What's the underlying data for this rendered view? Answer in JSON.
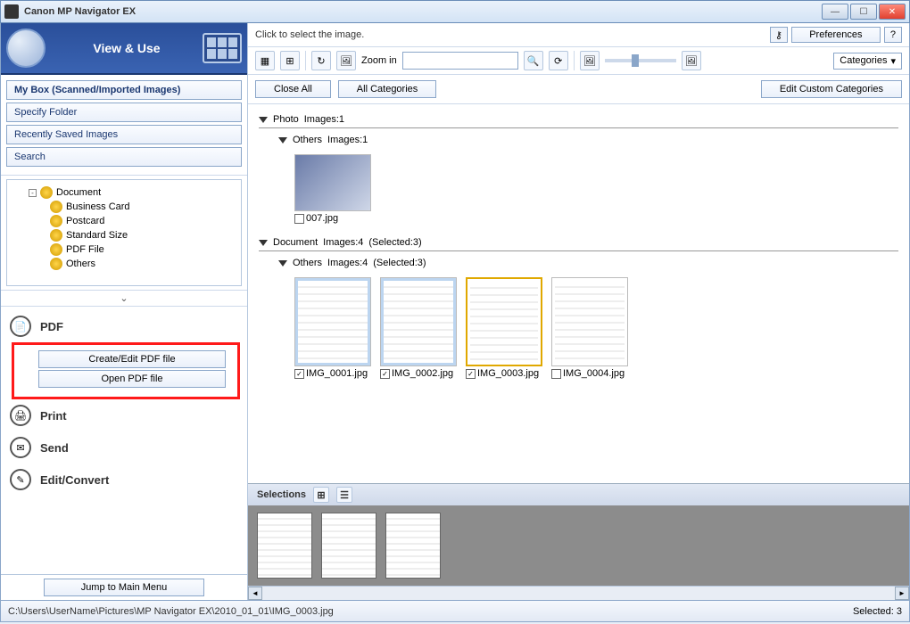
{
  "window": {
    "title": "Canon MP Navigator EX"
  },
  "sidebar": {
    "view_use": "View & Use",
    "items": [
      "My Box (Scanned/Imported Images)",
      "Specify Folder",
      "Recently Saved Images",
      "Search"
    ],
    "tree": {
      "root": "Document",
      "children": [
        "Business Card",
        "Postcard",
        "Standard Size",
        "PDF File",
        "Others"
      ]
    },
    "collapse_glyph": "⌄",
    "actions": {
      "pdf": {
        "label": "PDF",
        "sub": [
          "Create/Edit PDF file",
          "Open PDF file"
        ]
      },
      "print": "Print",
      "send": "Send",
      "edit": "Edit/Convert"
    },
    "jump": "Jump to Main Menu"
  },
  "top": {
    "hint": "Click to select the image.",
    "preferences": "Preferences",
    "help": "?"
  },
  "toolbar": {
    "zoom_label": "Zoom in",
    "categories": "Categories"
  },
  "buttons": {
    "close_all": "Close All",
    "all_cat": "All Categories",
    "edit_custom": "Edit Custom Categories"
  },
  "groups": {
    "photo": {
      "label": "Photo",
      "count": "Images:1",
      "others": {
        "label": "Others",
        "count": "Images:1",
        "items": [
          {
            "name": "007.jpg",
            "checked": false
          }
        ]
      }
    },
    "document": {
      "label": "Document",
      "count": "Images:4",
      "sel": "(Selected:3)",
      "others": {
        "label": "Others",
        "count": "Images:4",
        "sel": "(Selected:3)",
        "items": [
          {
            "name": "IMG_0001.jpg",
            "checked": true,
            "highlighted": true
          },
          {
            "name": "IMG_0002.jpg",
            "checked": true,
            "highlighted": true
          },
          {
            "name": "IMG_0003.jpg",
            "checked": true,
            "selected": true
          },
          {
            "name": "IMG_0004.jpg",
            "checked": false
          }
        ]
      }
    }
  },
  "selections": {
    "label": "Selections"
  },
  "status": {
    "path": "C:\\Users\\UserName\\Pictures\\MP Navigator EX\\2010_01_01\\IMG_0003.jpg",
    "selected": "Selected: 3"
  }
}
